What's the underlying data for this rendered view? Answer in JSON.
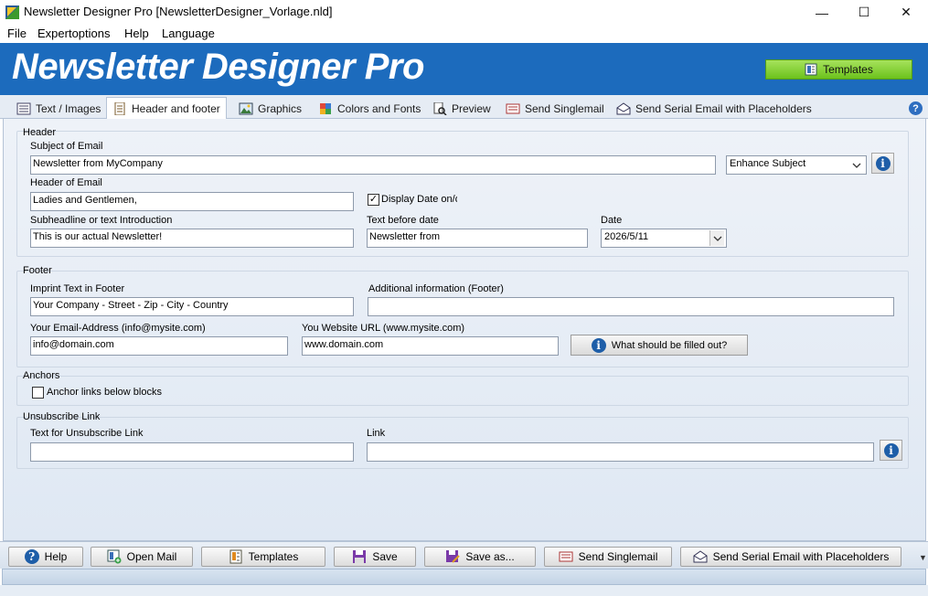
{
  "window": {
    "title": "Newsletter Designer Pro [NewsletterDesigner_Vorlage.nld]",
    "controls": {
      "minimize": "—",
      "maximize": "☐",
      "close": "✕"
    }
  },
  "menu": [
    "File",
    "Expertoptions",
    "Help",
    "Language"
  ],
  "banner": {
    "title": "Newsletter Designer Pro",
    "templates_label": "Templates",
    "color": "#1c6bbd"
  },
  "tabs": [
    {
      "label": "Text / Images",
      "icon": "text-images-icon"
    },
    {
      "label": "Header and footer",
      "icon": "document-icon",
      "active": true
    },
    {
      "label": "Graphics",
      "icon": "picture-icon"
    },
    {
      "label": "Colors and Fonts",
      "icon": "colors-icon"
    },
    {
      "label": "Preview",
      "icon": "preview-icon"
    },
    {
      "label": "Send Singlemail",
      "icon": "mail-icon"
    },
    {
      "label": "Send Serial Email with Placeholders",
      "icon": "serial-mail-icon"
    }
  ],
  "help_icon": "?",
  "header_section": {
    "title": "Header",
    "subject_label": "Subject of Email",
    "subject_value": "Newsletter from MyCompany",
    "enhance_subject": "Enhance Subject",
    "header_label": "Header of Email",
    "header_value": "Ladies and Gentlemen,",
    "display_date_label": "Display Date on/o",
    "display_date_checked": "✓",
    "subheadline_label": "Subheadline or text Introduction",
    "subheadline_value": "This is our actual Newsletter!",
    "text_before_date_label": "Text before date",
    "text_before_date_value": "Newsletter from",
    "date_label": "Date",
    "date_value": "2026/5/11"
  },
  "footer_section": {
    "title": "Footer",
    "imprint_label": "Imprint Text in Footer",
    "imprint_value": "Your Company - Street - Zip - City - Country",
    "additional_label": "Additional information (Footer)",
    "additional_value": "",
    "email_label": "Your Email-Address (info@mysite.com)",
    "email_value": "info@domain.com",
    "website_label": "You Website URL (www.mysite.com)",
    "website_value": "www.domain.com",
    "what_filled_label": "What should be filled out?"
  },
  "anchors_section": {
    "title": "Anchors",
    "anchor_links_label": "Anchor links below blocks"
  },
  "unsubscribe_section": {
    "title": "Unsubscribe Link",
    "text_label": "Text for Unsubscribe Link",
    "text_value": "",
    "link_label": "Link",
    "link_value": ""
  },
  "info_glyph": "i",
  "bottom_buttons": {
    "help": "Help",
    "open_mail": "Open Mail",
    "templates": "Templates",
    "save": "Save",
    "save_as": "Save as...",
    "send_singlemail": "Send Singlemail",
    "send_serial": "Send Serial Email with Placeholders"
  },
  "bar_scroll_glyph": "▼"
}
